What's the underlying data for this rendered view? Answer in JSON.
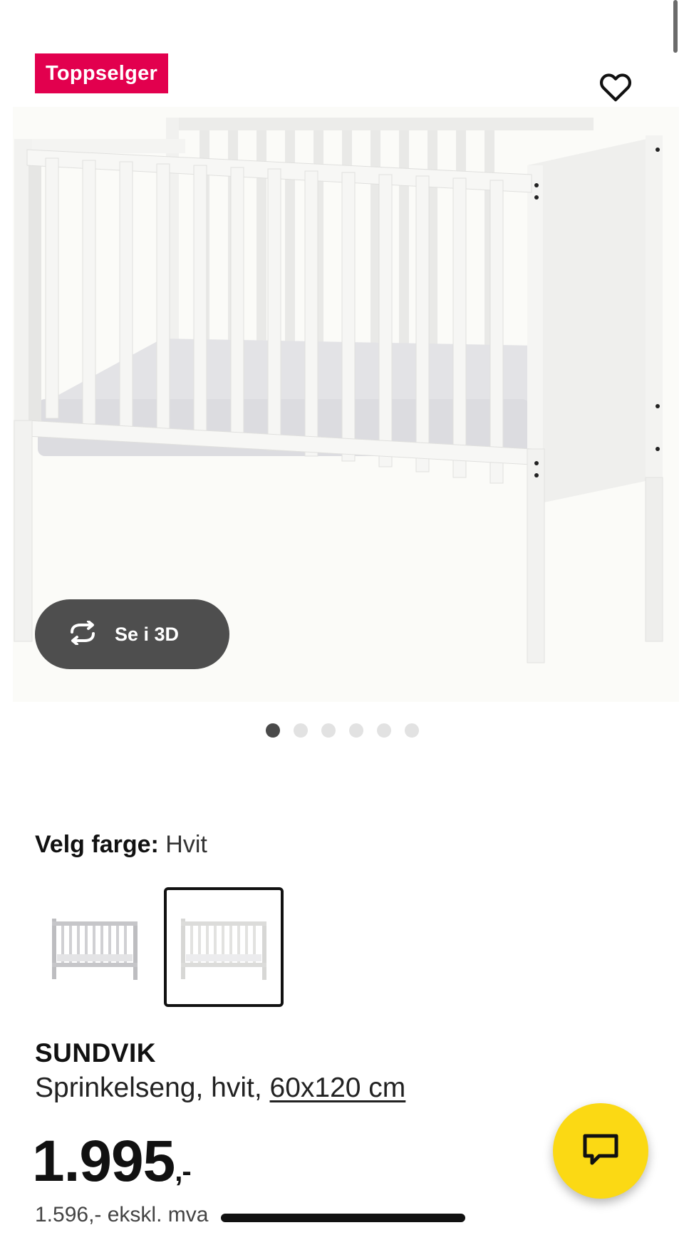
{
  "product": {
    "badge": "Toppselger",
    "view_3d_label": "Se i 3D",
    "color_label": "Velg farge:",
    "color_value": "Hvit",
    "name": "SUNDVIK",
    "description": "Sprinkelseng, hvit, ",
    "size": "60x120 cm",
    "price_integer": "1.995",
    "price_suffix": ",-",
    "price_ex_vat": "1.596,- ekskl. mva"
  },
  "gallery": {
    "image_count": 6,
    "active_index": 0
  },
  "swatches": [
    {
      "name": "Grå",
      "selected": false
    },
    {
      "name": "Hvit",
      "selected": true
    }
  ],
  "icons": {
    "favorite": "heart-icon",
    "view_3d": "rotate-icon",
    "chat": "chat-bubble-icon"
  },
  "colors": {
    "badge": "#e2004e",
    "chat_fab": "#fbd914",
    "button_3d": "#4e4e4e"
  }
}
